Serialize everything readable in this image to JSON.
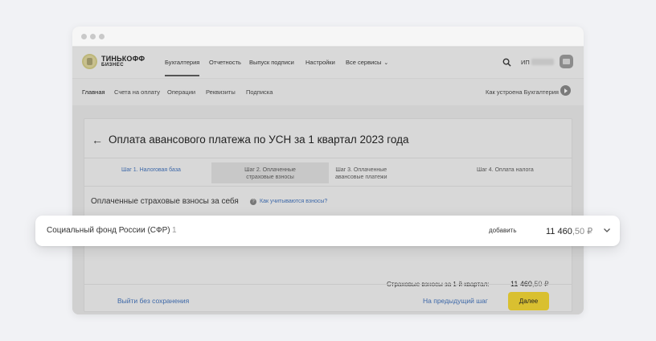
{
  "topnav": {
    "logo": {
      "line1": "ТИНЬКОФФ",
      "line2": "БИЗНЕС"
    },
    "items": [
      {
        "label": "Бухгалтерия",
        "active": true
      },
      {
        "label": "Отчетность"
      },
      {
        "label": "Выпуск подписи"
      },
      {
        "label": "Настройки"
      },
      {
        "label": "Все сервисы"
      }
    ],
    "user_label": "ИП"
  },
  "subnav": {
    "items": [
      {
        "label": "Главная",
        "active": true
      },
      {
        "label": "Счета на оплату"
      },
      {
        "label": "Операции"
      },
      {
        "label": "Реквизиты"
      },
      {
        "label": "Подписка"
      }
    ],
    "help": "Как устроена Бухгалтерия"
  },
  "page": {
    "title": "Оплата авансового платежа по УСН за 1 квартал 2023 года",
    "steps": [
      {
        "line1": "Шаг 1. Налоговая база",
        "line2": ""
      },
      {
        "line1": "Шаг 2. Оплаченные",
        "line2": "страховые взносы",
        "active": true
      },
      {
        "line1": "Шаг 3. Оплаченные",
        "line2": "авансовые платежи"
      },
      {
        "line1": "Шаг 4. Оплата налога",
        "line2": ""
      }
    ],
    "section_title": "Оплаченные страховые взносы за себя",
    "question_link": "Как учитываются взносы?",
    "total_label": "Страховые взносы за 1-й квартал:",
    "total_main": "11 460",
    "total_kopecks": ",50 ₽",
    "exit_label": "Выйти без сохранения",
    "prev_label": "На предыдущий шаг",
    "next_label": "Далее"
  },
  "popup": {
    "name": "Социальный фонд России (СФР)",
    "count": "1",
    "add_label": "добавить",
    "amount_main": "11 460",
    "amount_kopecks": ",50 ₽"
  },
  "colors": {
    "accent": "#d9c030",
    "link": "#3d68a8"
  }
}
